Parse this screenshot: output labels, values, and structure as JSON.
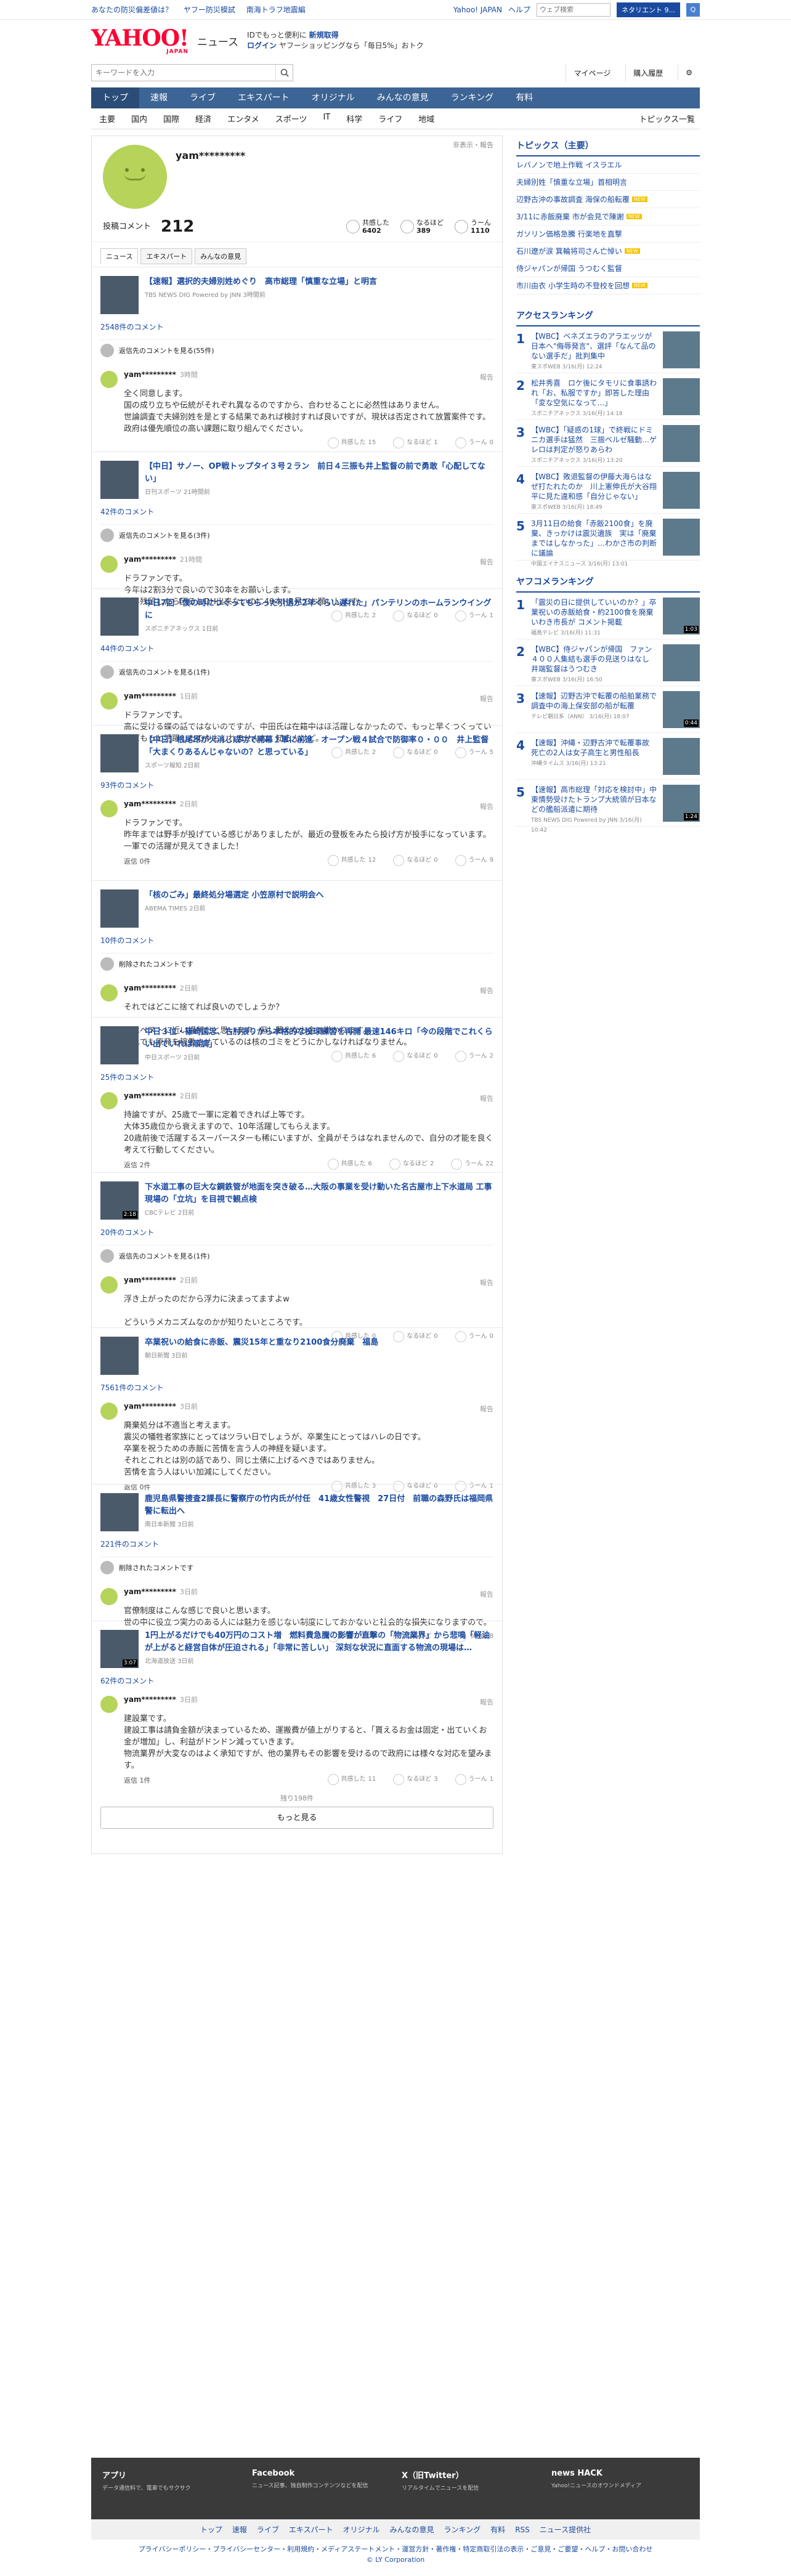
{
  "topbar": {
    "left1": "あなたの防災偏差値は？",
    "left2": "ヤフー防災模試",
    "left3": "南海トラフ地震編",
    "right1": "Yahoo! JAPAN",
    "right2": "ヘルプ",
    "search_ph": "ウェブ検索",
    "search_btn": "ネタリエント 9...",
    "q_icon": "Q"
  },
  "header": {
    "logo": "YAHOO!",
    "logo_sub": "JAPAN",
    "service": "ニュース",
    "promo1": "IDでもっと便利に",
    "promo_new": "新規取得",
    "promo_login": "ログイン",
    "promo2": "ヤフーショッピングなら「毎日5%」おトク"
  },
  "searchrow": {
    "ph": "キーワードを入力",
    "mypage": "マイページ",
    "history": "購入履歴"
  },
  "gnav": [
    "トップ",
    "速報",
    "ライブ",
    "エキスパート",
    "オリジナル",
    "みんなの意見",
    "ランキング",
    "有料"
  ],
  "snav": [
    "主要",
    "国内",
    "国際",
    "経済",
    "エンタメ",
    "スポーツ",
    "IT",
    "科学",
    "ライフ",
    "地域"
  ],
  "snav_all": "トピックス一覧",
  "profile": {
    "name": "yam*********",
    "privacy": "非表示・報告",
    "count_label": "投稿コメント",
    "count": "212",
    "s1l": "共感した",
    "s1v": "6402",
    "s2l": "なるほど",
    "s2v": "389",
    "s3l": "うーん",
    "s3v": "1110"
  },
  "tabs": [
    "ニュース",
    "エキスパート",
    "みんなの意見"
  ],
  "articles": [
    {
      "title": "【速報】選択的夫婦別姓めぐり　高市総理「慎重な立場」と明言",
      "src": "TBS NEWS DIG Powered by JNN 3時間前",
      "cc": "2548件のコメント",
      "rep": "返信先のコメントを見る(55件)",
      "time": "3時間",
      "text": "全く同意します。\n国の成り立ちや伝統がそれぞれ異なるのですから、合わせることに必然性はありません。\n世論調査で夫婦別姓を是とする結果であれば検討すれば良いですが、現状は否定されて放置案件です。\n政府は優先順位の高い課題に取り組んでください。",
      "r": [
        "15",
        "1",
        "0"
      ],
      "reply": "",
      "dur": ""
    },
    {
      "title": "【中日】サノー、OP戦トップタイ３号２ラン　前日４三振も井上監督の前で勇敢「心配してない」",
      "src": "日刊スポーツ 21時間前",
      "cc": "42件のコメント",
      "rep": "返信先のコメントを見る(3件)",
      "time": "21時間",
      "text": "ドラファンです。\n今年は2割3分で良いので30本をお願いします。\n来年残留したら困るしDH出来ないのに40本HR見てお願いします。",
      "r": [
        "2",
        "0",
        "1"
      ],
      "reply": "",
      "dur": ""
    },
    {
      "title": "中日7回「僕の時につくってもらった引退が2年くらい遅れた」パンテリンのホームランウイングに",
      "src": "スポニチアネックス 1日前",
      "cc": "44件のコメント",
      "rep": "返信先のコメントを見る(1件)",
      "time": "1日前",
      "text": "ドラファンです。\n高に受ける蝶の話ではないのですが、中田氏は在籍中はほ活躍しなかったので、もっと早くつくっていればもっと活躍したのかもしれませんね。知らんけど。",
      "r": [
        "2",
        "0",
        "5"
      ],
      "reply": "",
      "dur": ""
    },
    {
      "title": "【中日】根尾昂が火消し成功で開幕１軍に前進　オープン戦４試合で防御率０・００　井上監督「大まくりあるんじゃないの？と思っている」",
      "src": "スポーツ報知 2日前",
      "cc": "93件のコメント",
      "rep": "",
      "time": "2日前",
      "text": "ドラファンです。\n昨年までは野手が投げている感じがありましたが、最近の登板をみたら投げ方が投手になっています。\n一軍での活躍が見えてきました！",
      "r": [
        "12",
        "0",
        "9"
      ],
      "reply": "返信 0件",
      "dur": ""
    },
    {
      "title": "「核のごみ」最終処分場選定 小笠原村で説明会へ",
      "src": "ABEMA TIMES 2日前",
      "cc": "10件のコメント",
      "rep": "削除されたコメントです",
      "time": "2日前",
      "text": "それではどこに捨てれば良いのでしょうか？\n\n私はベストに近い場所だと思います。但し著えなお金は掛かります。\nそれでも原発を稼働させているのは核のゴミをどうにかしなければなりません。",
      "r": [
        "6",
        "0",
        "2"
      ],
      "reply": "",
      "dur": ""
    },
    {
      "title": "中日３位・篠崎国忠、右肘張りから本格的な投球練習を再開 最速146キロ「今の段階でこれくらい出ていれば順調」",
      "src": "中日スポーツ 2日前",
      "cc": "25件のコメント",
      "rep": "",
      "time": "2日前",
      "text": "持論ですが、25歳で一軍に定着できれば上等です。\n大体35歳位から衰えますので、10年活躍してもらえます。\n20歳前後で活躍するスーパースターも稀にいますが、全員がそうはなれませんので、自分の才能を良く考えて行動してください。",
      "r": [
        "6",
        "2",
        "22"
      ],
      "reply": "返信 2件",
      "dur": ""
    },
    {
      "title": "下水道工事の巨大な鋼鉄管が地面を突き破る…大阪の事業を受け動いた名古屋市上下水道局 工事現場の「立坑」を目視で観点検",
      "src": "CBCテレビ 2日前",
      "cc": "20件のコメント",
      "rep": "返信先のコメントを見る(1件)",
      "time": "2日前",
      "text": "浮き上がったのだから浮力に決まってますよw\n\nどういうメカニズムなのかが知りたいところです。",
      "r": [
        "0",
        "0",
        "0"
      ],
      "reply": "",
      "dur": "2:18"
    },
    {
      "title": "卒業祝いの給食に赤飯、震災15年と重なり2100食分廃棄　福島",
      "src": "朝日新聞 3日前",
      "cc": "7561件のコメント",
      "rep": "",
      "time": "3日前",
      "text": "廃棄処分は不適当と考えます。\n震災の犠牲者家族にとってはツラい日でしょうが、卒業生にとってはハレの日です。\n卒業を祝うための赤飯に苦情を言う人の神経を疑います。\nそれとこれとは別の話であり、同じ土俵に上げるべきではありません。\n苦情を言う人はいい加減にしてください。",
      "r": [
        "3",
        "0",
        "1"
      ],
      "reply": "返信 0件",
      "dur": ""
    },
    {
      "title": "鹿児島県警捜査2課長に警察庁の竹内氏が付任　41歳女性警視　27日付　前職の森野氏は福岡県警に転出へ",
      "src": "南日本新聞 3日前",
      "cc": "221件のコメント",
      "rep": "削除されたコメントです",
      "time": "3日前",
      "text": "官僚制度はこんな感じで良いと思います。\n世の中に役立つ実力のある人には魅力を感じない制度にしておかないと社会的な損失になりますので。",
      "r": [
        "16",
        "1",
        "8"
      ],
      "reply": "",
      "dur": ""
    },
    {
      "title": "1円上がるだけでも40万円のコスト増　燃料費急騰の影響が直撃の「物流業界」から悲鳴「軽油が上がると経営自体が圧迫される」「非常に苦しい」 深刻な状況に直面する物流の現場は…",
      "src": "北海道放送 3日前",
      "cc": "62件のコメント",
      "rep": "",
      "time": "3日前",
      "text": "建設業です。\n建設工事は請負金額が決まっているため、運搬費が値上がりすると、「貰えるお金は固定・出ていくお金が増加」し、利益がドンドン減っていきます。\n物流業界が大変なのはよく承知ですが、他の業界もその影響を受けるので政府には様々な対応を望みます。",
      "r": [
        "11",
        "3",
        "1"
      ],
      "reply": "返信 1件",
      "dur": "3:07"
    }
  ],
  "remaining": "残り198件",
  "more": "もっと見る",
  "side": {
    "topics_h": "トピックス（主要）",
    "topics": [
      {
        "t": "レバノンで地上作戦 イスラエル",
        "new": false
      },
      {
        "t": "夫婦別姓「慎重な立場」首相明言",
        "new": false
      },
      {
        "t": "辺野古沖の事故調査 海保の船転覆",
        "new": true
      },
      {
        "t": "3/11に赤飯廃棄 市が会見で陳謝",
        "new": true
      },
      {
        "t": "ガソリン価格急騰 行楽地を直撃",
        "new": false
      },
      {
        "t": "石川遼が涙 箕輪将司さん亡悼い",
        "new": true
      },
      {
        "t": "侍ジャパンが帰国 うつむく監督",
        "new": false
      },
      {
        "t": "市川由衣 小学生時の不登校を回想",
        "new": true
      }
    ],
    "new_label": "NEW",
    "access_h": "アクセスランキング",
    "access": [
      {
        "t": "【WBC】ベネズエラのアラエッツが日本へ\"侮辱発言\"、選評「なんて品のない選手だ」批判集中",
        "s": "東スポWEB 3/16(月) 12:24"
      },
      {
        "t": "松井秀喜　ロケ後にタモリに食事誘われ「お、私服ですか」即答した理由「変な空気になって…」",
        "s": "スポニチアネックス 3/16(月) 14:18"
      },
      {
        "t": "【WBC】「疑惑の1球」で終戦にドミニカ選手は猛然　三振ベルゼ騒動…ゲレロは判定が怒りあらわ",
        "s": "スポニチアネックス 3/16(月) 13:20"
      },
      {
        "t": "【WBC】敗退監督の伊藤大海らはなぜ打たれたのか　川上憲伸氏が大谷翔平に見た違和感「自分じゃない」",
        "s": "東スポWEB 3/16(月) 18:49"
      },
      {
        "t": "3月11日の給食「赤飯2100食」を廃棄、きっかけは震災遺族　実は「廃棄まではしなかった」…わかさ市の判断に議論",
        "s": "中国エイナスニュース 3/16(月) 13:01"
      }
    ],
    "yafuko_h": "ヤフコメランキング",
    "yafuko": [
      {
        "t": "「震災の日に提供していいのか？」卒業祝いの赤飯給食・約2100食を廃棄　いわき市長が コメント掲載",
        "s": "福島テレビ 3/16(月) 11:31",
        "d": "1:03"
      },
      {
        "t": "【WBC】侍ジャパンが帰国　ファン４００人集結も選手の見送りはなし　井端監督はうつむき",
        "s": "東スポWEB 3/16(月) 16:50",
        "d": ""
      },
      {
        "t": "【速報】辺野古沖で転覆の船舶業務で調査中の海上保安部の船が転覆",
        "s": "テレビ朝日系（ANN） 3/16(月) 18:07",
        "d": "0:44"
      },
      {
        "t": "【速報】沖縄・辺野古沖で転覆事故　死亡の2人は女子高生と男性船長",
        "s": "沖縄タイムス 3/16(月) 13:21",
        "d": ""
      },
      {
        "t": "【速報】高市総理「対応を検討中」中東情勢受けたトランプ大統領が日本などの艦船派遣に期待",
        "s": "TBS NEWS DIG Powered by JNN 3/16(月) 10:42",
        "d": "1:24"
      }
    ]
  },
  "footer": [
    {
      "h": "アプリ",
      "s": "データ通信料で、電車でもサクサク"
    },
    {
      "h": "Facebook",
      "s": "ニュース記事、独自制作コンテンツなどを配信"
    },
    {
      "h": "X（旧Twitter）",
      "s": "リアルタイムでニュースを配信"
    },
    {
      "h": "news HACK",
      "s": "Yahoo!ニュースのオウンドメディア"
    }
  ],
  "fnav": [
    "トップ",
    "速報",
    "ライブ",
    "エキスパート",
    "オリジナル",
    "みんなの意見",
    "ランキング",
    "有料",
    "RSS",
    "ニュース提供社"
  ],
  "legal1": "プライバシーポリシー・プライバシーセンター・利用規約・メディアステートメント・運営方針・著作権・特定商取引法の表示・ご意見・ご要望・ヘルプ・お問い合わせ",
  "legal2": "© LY Corporation"
}
